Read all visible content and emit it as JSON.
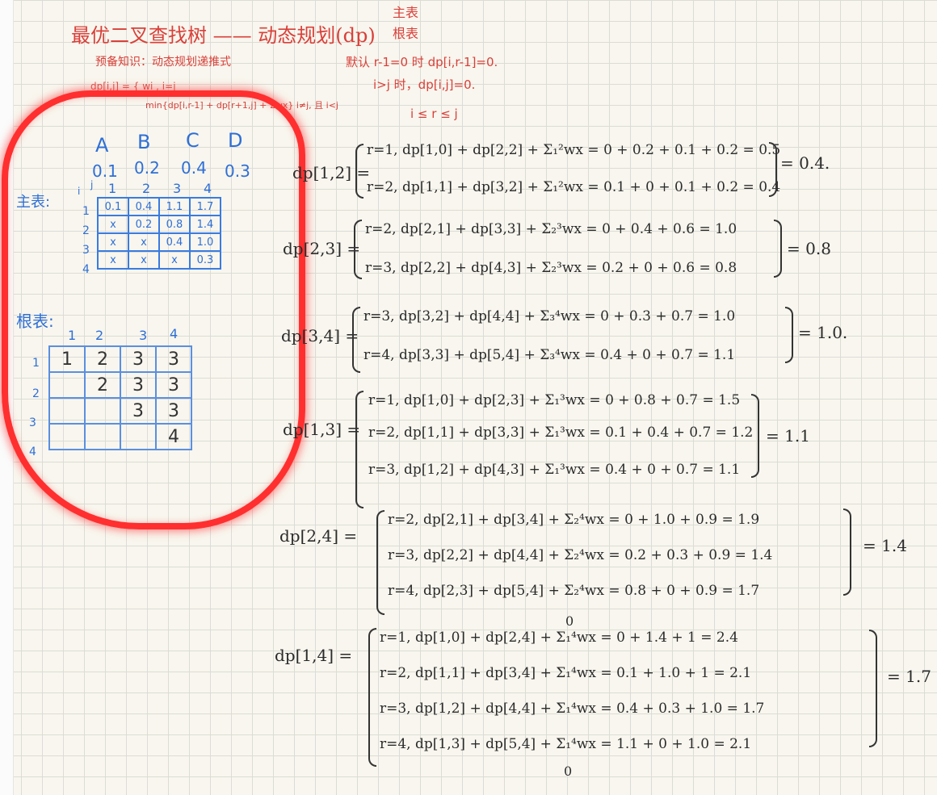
{
  "title": "最优二叉查找树 —— 动态规划(dp)",
  "brace_notes": [
    "主表",
    "根表"
  ],
  "prereq": "预备知识：动态规划递推式",
  "defaults": [
    "默认 r-1=0 时 dp[i,r-1]=0.",
    "i>j 时，dp[i,j]=0."
  ],
  "recurrence": {
    "line1": "dp[i,j] = { wi , i=j",
    "line2": "min{dp[i,r-1] + dp[r+1,j] + Σwx}  i≠j, 且 i<j",
    "range": "i ≤ r ≤ j"
  },
  "items": {
    "keys": [
      "A",
      "B",
      "C",
      "D"
    ],
    "weights": [
      "0.1",
      "0.2",
      "0.4",
      "0.3"
    ]
  },
  "main_table": {
    "label": "主表:",
    "corner": "i",
    "corner_j": "j",
    "col_headers": [
      "1",
      "2",
      "3",
      "4"
    ],
    "row_headers": [
      "1",
      "2",
      "3",
      "4"
    ],
    "rows": [
      [
        "0.1",
        "0.4",
        "1.1",
        "1.7"
      ],
      [
        "x",
        "0.2",
        "0.8",
        "1.4"
      ],
      [
        "x",
        "x",
        "0.4",
        "1.0"
      ],
      [
        "x",
        "x",
        "x",
        "0.3"
      ]
    ]
  },
  "root_table": {
    "label": "根表:",
    "col_headers": [
      "1",
      "2",
      "3",
      "4"
    ],
    "row_headers": [
      "1",
      "2",
      "3",
      "4"
    ],
    "rows": [
      [
        "1",
        "2",
        "3",
        "3"
      ],
      [
        "",
        "2",
        "3",
        "3"
      ],
      [
        "",
        "",
        "3",
        "3"
      ],
      [
        "",
        "",
        "",
        "4"
      ]
    ]
  },
  "equations": [
    {
      "lhs": "dp[1,2] =",
      "cases": [
        "r=1, dp[1,0] + dp[2,2] + Σ₁²wx = 0 + 0.2 + 0.1 + 0.2 = 0.5",
        "r=2, dp[1,1] + dp[3,2] + Σ₁²wx = 0.1 + 0 + 0.1 + 0.2 = 0.4"
      ],
      "result": "= 0.4."
    },
    {
      "lhs": "dp[2,3] =",
      "cases": [
        "r=2, dp[2,1] + dp[3,3] + Σ₂³wx = 0 + 0.4 + 0.6 = 1.0",
        "r=3, dp[2,2] + dp[4,3] + Σ₂³wx = 0.2 + 0 + 0.6 = 0.8"
      ],
      "result": "= 0.8"
    },
    {
      "lhs": "dp[3,4] =",
      "cases": [
        "r=3, dp[3,2] + dp[4,4] + Σ₃⁴wx = 0 + 0.3 + 0.7 = 1.0",
        "r=4, dp[3,3] + dp[5,4] + Σ₃⁴wx = 0.4 + 0 + 0.7 = 1.1"
      ],
      "result": "= 1.0."
    },
    {
      "lhs": "dp[1,3] =",
      "cases": [
        "r=1, dp[1,0] + dp[2,3] + Σ₁³wx = 0 + 0.8 + 0.7 = 1.5",
        "r=2, dp[1,1] + dp[3,3] + Σ₁³wx = 0.1 + 0.4 + 0.7 = 1.2",
        "r=3, dp[1,2] + dp[4,3] + Σ₁³wx = 0.4 + 0 + 0.7 = 1.1"
      ],
      "result": "= 1.1"
    },
    {
      "lhs": "dp[2,4] =",
      "cases": [
        "r=2, dp[2,1] + dp[3,4] + Σ₂⁴wx = 0 + 1.0 + 0.9 = 1.9",
        "r=3, dp[2,2] + dp[4,4] + Σ₂⁴wx = 0.2 + 0.3 + 0.9 = 1.4",
        "r=4, dp[2,3] + dp[5,4] + Σ₂⁴wx = 0.8 + 0 + 0.9 = 1.7"
      ],
      "result": "= 1.4"
    },
    {
      "lhs": "dp[1,4] =",
      "cases": [
        "r=1, dp[1,0] + dp[2,4] + Σ₁⁴wx = 0 + 1.4 + 1 = 2.4",
        "r=2, dp[1,1] + dp[3,4] + Σ₁⁴wx = 0.1 + 1.0 + 1 = 2.1",
        "r=3, dp[1,2] + dp[4,4] + Σ₁⁴wx = 0.4 + 0.3 + 1.0 = 1.7",
        "r=4, dp[1,3] + dp[5,4] + Σ₁⁴wx = 1.1 + 0 + 1.0 = 2.1"
      ],
      "result": "= 1.7",
      "notes": [
        "0",
        "0"
      ]
    }
  ]
}
